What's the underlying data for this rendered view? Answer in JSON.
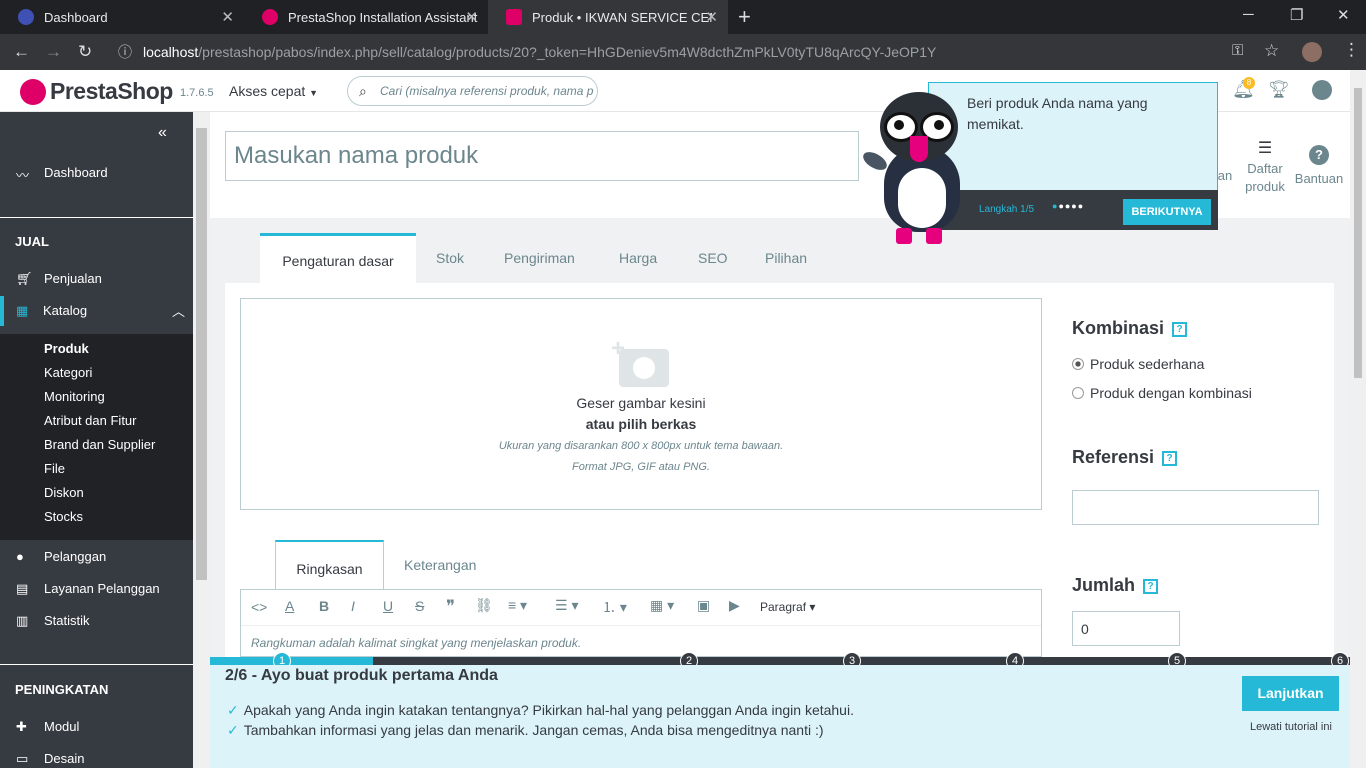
{
  "browser": {
    "tabs": [
      {
        "title": "Dashboard",
        "icon": "globe-icon"
      },
      {
        "title": "PrestaShop Installation Assistant",
        "icon": "prestashop-icon"
      },
      {
        "title": "Produk • IKWAN SERVICE CENTE",
        "icon": "prestashop-admin-icon"
      }
    ],
    "url_host": "localhost",
    "url_path": "/prestashop/pabos/index.php/sell/catalog/products/20?_token=HhGDeniev5m4W8dcthZmPkLV0tyTU8qArcQY-JeOP1Y",
    "new_tab": "+",
    "notif_count": "8"
  },
  "header": {
    "logo": "PrestaShop",
    "version": "1.7.6.5",
    "quick_access": "Akses cepat",
    "search_placeholder": "Cari (misalnya referensi produk, nama p"
  },
  "sidebar": {
    "dashboard": "Dashboard",
    "section_sell": "JUAL",
    "sales": "Penjualan",
    "catalog": "Katalog",
    "catalog_items": [
      "Produk",
      "Kategori",
      "Monitoring",
      "Atribut dan Fitur",
      "Brand dan Supplier",
      "File",
      "Diskon",
      "Stocks"
    ],
    "customers": "Pelanggan",
    "customer_service": "Layanan Pelanggan",
    "stats": "Statistik",
    "section_improve": "PENINGKATAN",
    "modules": "Modul",
    "design": "Desain"
  },
  "toolbar": {
    "partial_label": "llan",
    "product_list_line1": "Daftar",
    "product_list_line2": "produk",
    "help": "Bantuan"
  },
  "product": {
    "name_placeholder": "Masukan nama produk",
    "tabs": [
      "Pengaturan dasar",
      "Stok",
      "Pengiriman",
      "Harga",
      "SEO",
      "Pilihan"
    ],
    "drop_line1": "Geser gambar kesini",
    "drop_line2": "atau pilih berkas",
    "drop_line3": "Ukuran yang disarankan 800 x 800px untuk tema bawaan.",
    "drop_line4": "Format JPG, GIF atau PNG.",
    "desc_tabs": [
      "Ringkasan",
      "Keterangan"
    ],
    "paragraph_select": "Paragraf",
    "summary_placeholder": "Rangkuman adalah kalimat singkat yang menjelaskan produk."
  },
  "right": {
    "combinations_title": "Kombinasi",
    "simple_product": "Produk sederhana",
    "combination_product": "Produk dengan kombinasi",
    "reference_title": "Referensi",
    "reference_value": "",
    "quantity_title": "Jumlah",
    "quantity_value": "0",
    "help_mark": "?"
  },
  "popup": {
    "text": "Beri produk Anda nama yang memikat.",
    "step": "Langkah 1/5",
    "next": "BERIKUTNYA"
  },
  "tutorial": {
    "steps": [
      "1",
      "2",
      "3",
      "4",
      "5",
      "6"
    ],
    "progress_fraction": 0.143,
    "title": "2/6 - Ayo buat produk pertama Anda",
    "item1": "Apakah yang Anda ingin katakan tentangnya? Pikirkan hal-hal yang pelanggan Anda ingin ketahui.",
    "item2": "Tambahkan informasi yang jelas dan menarik. Jangan cemas, Anda bisa mengeditnya nanti :)",
    "continue": "Lanjutkan",
    "skip": "Lewati tutorial ini"
  },
  "colors": {
    "accent": "#25b9d7",
    "sidebar": "#363a41",
    "brand": "#df0067"
  }
}
